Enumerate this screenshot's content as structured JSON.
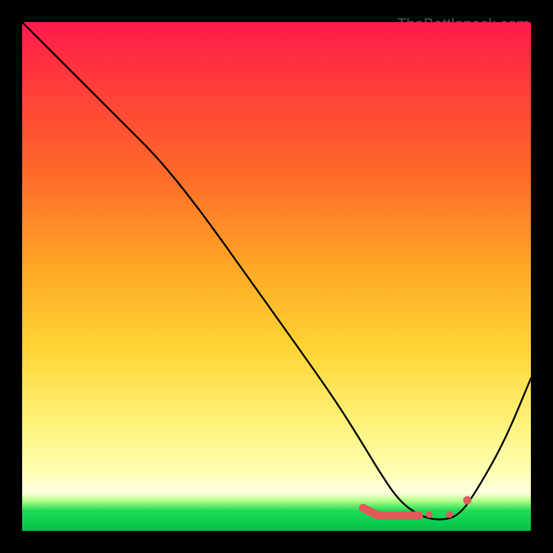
{
  "watermark": "TheBottleneck.com",
  "chart_data": {
    "type": "line",
    "title": "",
    "xlabel": "",
    "ylabel": "",
    "xlim": [
      0,
      1
    ],
    "ylim": [
      0,
      1
    ],
    "series": [
      {
        "name": "bottleneck-curve",
        "x": [
          0.0,
          0.1,
          0.2,
          0.27,
          0.35,
          0.45,
          0.55,
          0.62,
          0.67,
          0.7,
          0.74,
          0.78,
          0.82,
          0.86,
          0.9,
          0.95,
          1.0
        ],
        "y": [
          1.0,
          0.9,
          0.8,
          0.73,
          0.63,
          0.49,
          0.35,
          0.25,
          0.17,
          0.12,
          0.06,
          0.03,
          0.02,
          0.03,
          0.09,
          0.18,
          0.3
        ]
      }
    ],
    "markers": [
      {
        "name": "highlight-L-start",
        "x": 0.67,
        "y": 0.045
      },
      {
        "name": "highlight-L-corner",
        "x": 0.7,
        "y": 0.03
      },
      {
        "name": "highlight-L-end",
        "x": 0.78,
        "y": 0.03
      },
      {
        "name": "dot-1",
        "x": 0.8,
        "y": 0.032
      },
      {
        "name": "dot-2",
        "x": 0.84,
        "y": 0.032
      },
      {
        "name": "dot-3-on-rise",
        "x": 0.875,
        "y": 0.06
      }
    ],
    "marker_color": "#e05a5a",
    "curve_color": "#000000"
  }
}
